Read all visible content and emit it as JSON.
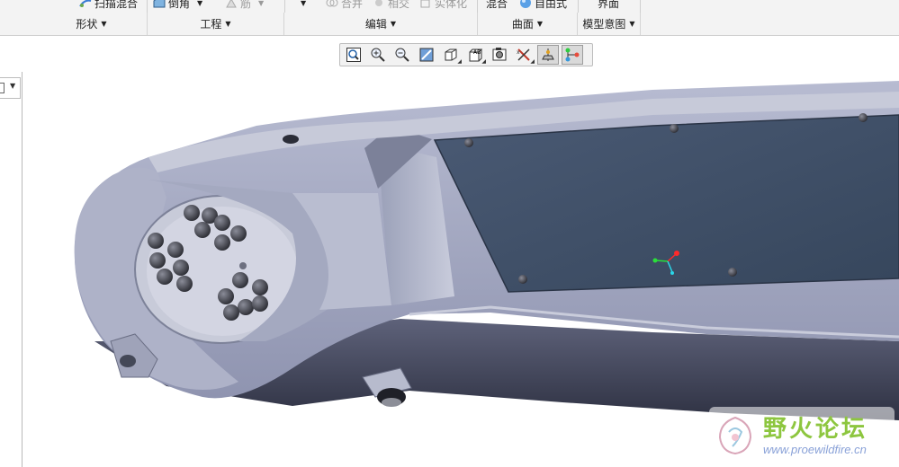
{
  "ribbon": {
    "top_items": [
      {
        "label": "扫描混合",
        "disabled": false
      },
      {
        "label": "倒角",
        "disabled": false
      },
      {
        "label": "筋",
        "disabled": true
      },
      {
        "label": "合并",
        "disabled": true
      },
      {
        "label": "相交",
        "disabled": true
      },
      {
        "label": "实体化",
        "disabled": true
      },
      {
        "label": "混合",
        "disabled": false
      },
      {
        "label": "自由式",
        "disabled": false
      },
      {
        "label": "界面",
        "disabled": false
      }
    ],
    "groups": [
      {
        "label": "形状"
      },
      {
        "label": "工程"
      },
      {
        "label": "编辑"
      },
      {
        "label": "曲面"
      },
      {
        "label": "模型意图"
      }
    ]
  },
  "graphics_toolbar": {
    "buttons": [
      {
        "icon": "refit-icon",
        "pressed": false
      },
      {
        "icon": "zoom-in-icon",
        "pressed": false
      },
      {
        "icon": "zoom-out-icon",
        "pressed": false
      },
      {
        "icon": "repaint-icon",
        "pressed": false
      },
      {
        "icon": "display-style-icon",
        "pressed": false
      },
      {
        "icon": "saved-orientations-icon",
        "pressed": false
      },
      {
        "icon": "view-manager-icon",
        "pressed": false
      },
      {
        "icon": "datum-display-filters-icon",
        "pressed": false
      },
      {
        "icon": "spin-center-icon",
        "pressed": true
      },
      {
        "icon": "annotation-display-icon",
        "pressed": true
      }
    ]
  },
  "colors": {
    "part_surface": "#9ea3bf",
    "part_dark": "#3c3f53",
    "panel": "#3f5068",
    "csys_x": "#ff2a2a",
    "csys_y": "#2adf3a",
    "csys_z": "#2ad6e8"
  },
  "watermark": {
    "title": "野火论坛",
    "url": "www.proewildfire.cn"
  }
}
